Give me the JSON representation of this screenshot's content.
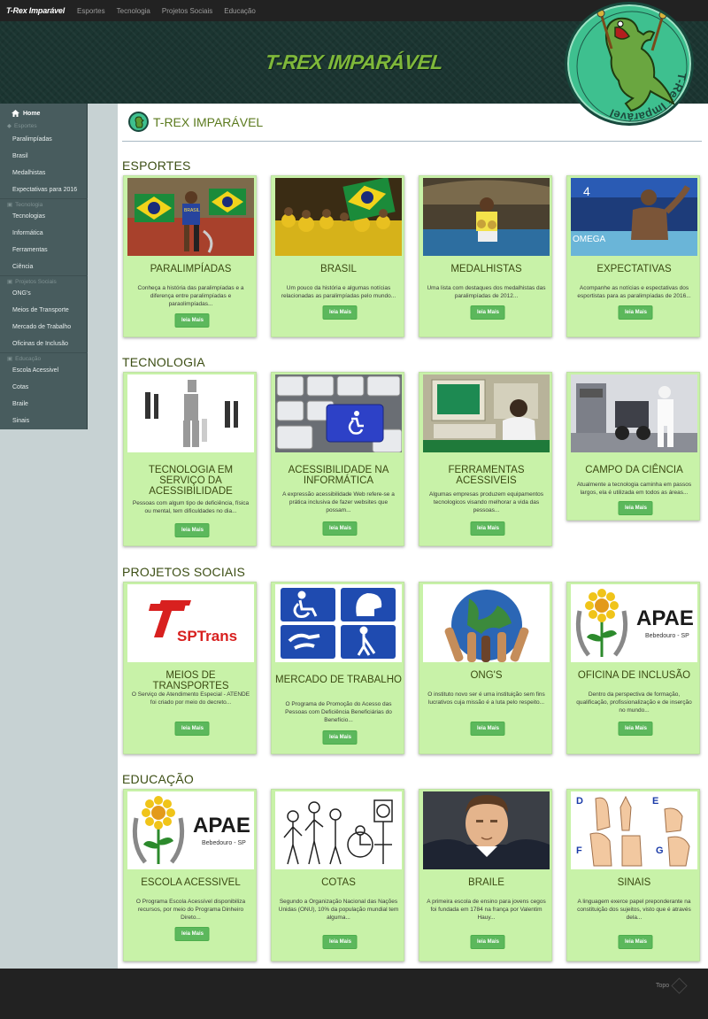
{
  "nav": {
    "brand": "T-Rex Imparável",
    "links": [
      "Esportes",
      "Tecnologia",
      "Projetos Sociais",
      "Educação"
    ]
  },
  "banner": {
    "title": "T-REX IMPARÁVEL",
    "logo_text": "T-Rex Imparável"
  },
  "sidebar": {
    "home": "Home",
    "groups": [
      {
        "title": "Esportes",
        "items": [
          "Paralimpíadas",
          "Brasil",
          "Medalhistas",
          "Expectativas para 2016"
        ]
      },
      {
        "title": "Tecnologia",
        "items": [
          "Tecnologias",
          "Informática",
          "Ferramentas",
          "Ciência"
        ]
      },
      {
        "title": "Projetos Sociais",
        "items": [
          "ONG's",
          "Meios de Transporte",
          "Mercado de Trabalho",
          "Oficinas de Inclusão"
        ]
      },
      {
        "title": "Educação",
        "items": [
          "Escola Acessivel",
          "Cotas",
          "Braile",
          "Sinais"
        ]
      }
    ]
  },
  "page_title": "T-REX IMPARÁVEL",
  "read_more": "leia Mais",
  "sections": [
    {
      "title": "ESPORTES",
      "cards": [
        {
          "title": "PARALIMPÍADAS",
          "desc": "Conheça a história das paralimpíadas e a diferença entre paralimpíadas e paraolimpíadas..."
        },
        {
          "title": "BRASIL",
          "desc": "Um pouco da história e algumas notícias relacionadas as paralimpíadas pelo mundo..."
        },
        {
          "title": "MEDALHISTAS",
          "desc": "Uma lista com destaques dos medalhistas das paralimpíadas de 2012..."
        },
        {
          "title": "EXPECTATIVAS",
          "desc": "Acompanhe as notícias e espectativas dos esportistas para as paralimpíadas de 2016..."
        }
      ]
    },
    {
      "title": "TECNOLOGIA",
      "cards": [
        {
          "title": "TECNOLOGIA EM SERVIÇO DA ACESSIBILIDADE",
          "desc": "Pessoas com algum tipo de deficiência, física ou mental, tem dificuldades no dia..."
        },
        {
          "title": "ACESSIBILIDADE NA INFORMÁTICA",
          "desc": "A expressão acessibilidade Web refere-se a prática inclusiva de fazer websites que possam..."
        },
        {
          "title": "FERRAMENTAS ACESSIVEIS",
          "desc": "Algumas empresas produzem equipamentos tecnologicos visando melhorar a vida das pessoas..."
        },
        {
          "title": "CAMPO DA CIÊNCIA",
          "desc": "Atualmente a tecnologia caminha em passos largos, ela é utilizada em todos as áreas..."
        }
      ]
    },
    {
      "title": "PROJETOS SOCIAIS",
      "cards": [
        {
          "title": "MEIOS DE TRANSPORTES",
          "desc": "O Serviço de Atendimento Especial - ATENDE foi criado por meio do decreto..."
        },
        {
          "title": "MERCADO DE TRABALHO",
          "desc": "O Programa de Promoção do Acesso das Pessoas com Deficiência Beneficiárias do Benefício..."
        },
        {
          "title": "ONG'S",
          "desc": "O instituto novo ser é uma instituição sem fins lucrativos cuja missão é a luta pelo respeito..."
        },
        {
          "title": "OFICINA DE INCLUSÃO",
          "desc": "Dentro da perspectiva de formação, qualificação, profissionalização e de inserção no mundo..."
        }
      ]
    },
    {
      "title": "EDUCAÇÃO",
      "cards": [
        {
          "title": "ESCOLA ACESSIVEL",
          "desc": "O Programa Escola Acessível disponibiliza recursos, por meio do Programa Dinheiro Direto..."
        },
        {
          "title": "COTAS",
          "desc": "Segundo a Organização Nacional das Nações Unidas (ONU), 10% da população mundial tem alguma..."
        },
        {
          "title": "BRAILE",
          "desc": "A primeira escola de ensino para jovens cegos foi fundada em 1784 na frança por Valentim Hauy..."
        },
        {
          "title": "SINAIS",
          "desc": "A linguagem exerce papel preponderante na constituição dos sujeitos, visto que é através dela..."
        }
      ]
    }
  ],
  "images": {
    "sptrans": "SPTrans",
    "apae": "APAE",
    "apae_sub": "Bebedouro - SP",
    "brasil_shirt": "BRASIL",
    "omega": "OMEGA",
    "swim_number": "4"
  },
  "footer": {
    "topo": "Topo"
  },
  "colors": {
    "card_bg": "#c8f2a8",
    "button": "#5cb85c",
    "banner_title": "#7fb83a",
    "sidebar": "#485c5e"
  }
}
